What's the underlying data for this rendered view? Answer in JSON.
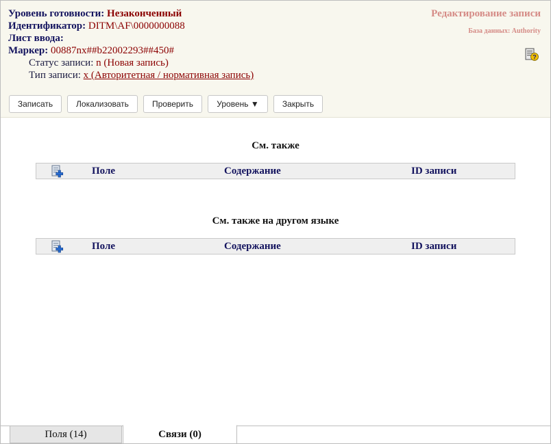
{
  "header": {
    "readiness_label": "Уровень готовности:",
    "readiness_value": "Незаконченный",
    "identifier_label": "Идентификатор:",
    "identifier_value": "DITM\\AF\\0000000088",
    "input_sheet_label": "Лист ввода:",
    "marker_label": "Маркер:",
    "marker_value": "00887nx##b22002293##450#",
    "record_status_label": "Статус записи:",
    "record_status_value": "n (Новая запись)",
    "record_type_label": "Тип записи:",
    "record_type_value": "x (Авторитетная / нормативная запись)",
    "edit_title": "Редактирование записи",
    "database_label": "База данных: Authority",
    "help_icon": "help-book-icon"
  },
  "toolbar": {
    "save": "Записать",
    "localize": "Локализовать",
    "check": "Проверить",
    "level": "Уровень ▼",
    "close": "Закрыть"
  },
  "sections": [
    {
      "title": "См. также",
      "add_icon": "add-row-icon",
      "columns": [
        "Поле",
        "Содержание",
        "ID записи"
      ]
    },
    {
      "title": "См. также на другом языке",
      "add_icon": "add-row-icon",
      "columns": [
        "Поле",
        "Содержание",
        "ID записи"
      ]
    }
  ],
  "tabs": [
    {
      "label": "Поля (14)",
      "active": false
    },
    {
      "label": "Связи (0)",
      "active": true
    }
  ]
}
